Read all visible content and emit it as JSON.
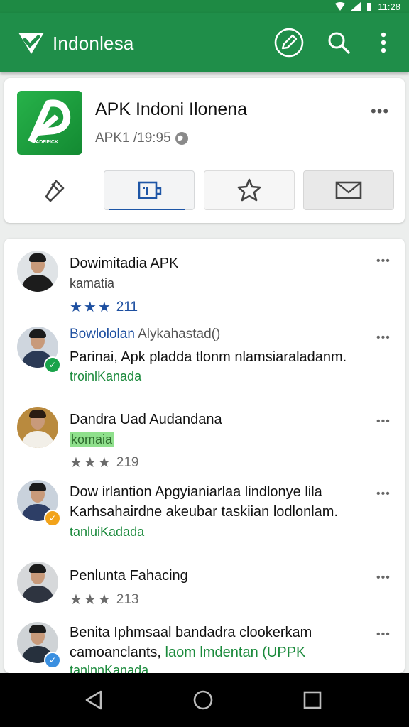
{
  "status_bar": {
    "time": "11:28"
  },
  "app_bar": {
    "title": "Indonlesa",
    "icons": [
      "shield-check-logo",
      "edit-circle-icon",
      "search-icon",
      "more-vert-icon"
    ]
  },
  "app_card": {
    "name": "APK Indoni Ilonena",
    "subtitle": "APK1 /19:95",
    "icon_tag": "PADRPICK",
    "tabs": [
      {
        "icon": "share-icon"
      },
      {
        "icon": "info-icon",
        "selected": true
      },
      {
        "icon": "star-icon"
      },
      {
        "icon": "mail-icon"
      }
    ]
  },
  "reviews": [
    {
      "name": "Dowimitadia APK",
      "line": "kamatia",
      "stars": 3,
      "star_color": "#1d4fa0",
      "count": "211"
    },
    {
      "name_blue": "Bowlololan",
      "name_rest": " Alykahastad()",
      "line": "Parinai, Apk pladda tlonm nlamsiaraladanm.",
      "sub": "troinlKanada",
      "badge": "#1aa34a"
    },
    {
      "name": "Dandra Uad Audandana",
      "line_highlight": "komaia",
      "stars": 3,
      "star_color": "#6b6b6b",
      "count": "219"
    },
    {
      "name": "Dow irlantion",
      "name_rest": " Apgyianiarlaa lindlonye lila",
      "line": "Karhsahairdne akeubar taskiian lodlonlam.",
      "sub": "tanluiKadada",
      "badge": "#f2a31b"
    },
    {
      "name": "Penlunta Fahacing",
      "stars": 3,
      "star_color": "#6b6b6b",
      "count": "213"
    },
    {
      "name": "Benita Iphmsaal bandadra clookerkam",
      "line": "camoanclants, ",
      "line_green": "laom lmdentan (UPPK",
      "sub": "tanlnnKanada",
      "badge": "#3a8fe0"
    }
  ],
  "nav_bar": {
    "buttons": [
      "back-icon",
      "home-icon",
      "recents-icon"
    ]
  }
}
